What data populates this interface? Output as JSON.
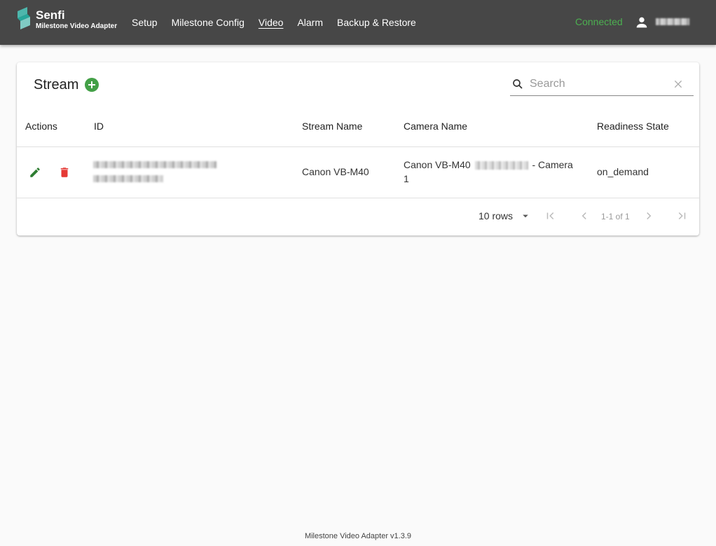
{
  "app": {
    "brand_name": "Senfi",
    "brand_subtitle": "Milestone Video Adapter",
    "nav": [
      "Setup",
      "Milestone Config",
      "Video",
      "Alarm",
      "Backup & Restore"
    ],
    "active_nav": "Video",
    "connection_status": "Connected",
    "colors": {
      "header_bg": "#474747",
      "status_green": "#4caf50",
      "add_green": "#43a047",
      "edit_green": "#2e7d32",
      "delete_red": "#e53935"
    }
  },
  "card": {
    "title": "Stream",
    "search": {
      "placeholder": "Search",
      "value": ""
    },
    "columns": [
      "Actions",
      "ID",
      "Stream Name",
      "Camera Name",
      "Readiness State"
    ],
    "rows": [
      {
        "stream_name": "Canon VB-M40",
        "camera_name_prefix": "Canon VB-M40",
        "camera_name_suffix": "- Camera 1",
        "readiness_state": "on_demand"
      }
    ],
    "pagination": {
      "rows_per_page": "10 rows",
      "range": "1-1 of 1"
    }
  },
  "footer": {
    "version": "Milestone Video Adapter v1.3.9"
  }
}
